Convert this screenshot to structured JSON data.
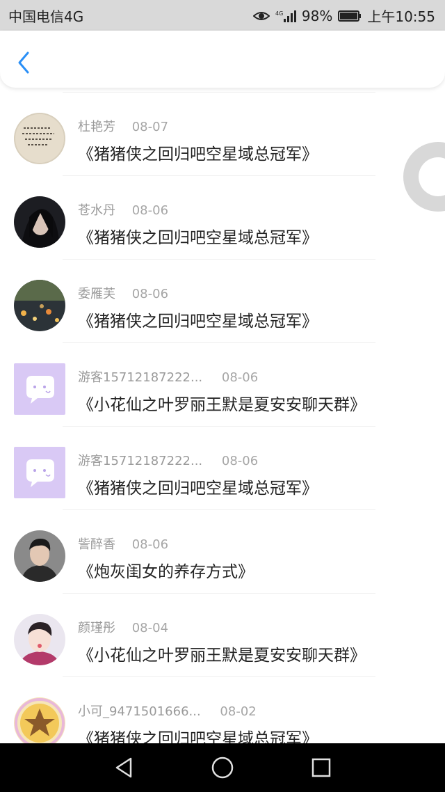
{
  "status_bar": {
    "carrier": "中国电信4G",
    "network": "4G",
    "battery": "98%",
    "time": "上午10:55"
  },
  "header": {
    "back_icon": "chevron-left-icon",
    "accent_color": "#2a8ff7"
  },
  "items": [
    {
      "name": "杜艳芳",
      "date": "08-07",
      "title": "《猪猪侠之回归吧空星域总冠军》",
      "avatar": "calligraphy-photo"
    },
    {
      "name": "苍水丹",
      "date": "08-06",
      "title": "《猪猪侠之回归吧空星域总冠军》",
      "avatar": "girl-portrait"
    },
    {
      "name": "委雁芙",
      "date": "08-06",
      "title": "《猪猪侠之回归吧空星域总冠军》",
      "avatar": "night-lights"
    },
    {
      "name": "游客15712187222...",
      "date": "08-06",
      "title": "《小花仙之叶罗丽王默是夏安安聊天群》",
      "avatar": "chat-bubble-purple"
    },
    {
      "name": "游客15712187222...",
      "date": "08-06",
      "title": "《猪猪侠之回归吧空星域总冠军》",
      "avatar": "chat-bubble-purple"
    },
    {
      "name": "訾醉香",
      "date": "08-06",
      "title": "《炮灰闺女的养存方式》",
      "avatar": "boy-portrait"
    },
    {
      "name": "颜瑾彤",
      "date": "08-04",
      "title": "《小花仙之叶罗丽王默是夏安安聊天群》",
      "avatar": "child-selfie"
    },
    {
      "name": "小可_9471501666...",
      "date": "08-02",
      "title": "《猪猪侠之回归吧空星域总冠军》",
      "avatar": "star-badge"
    }
  ],
  "nav_bar": {
    "back": "triangle-back-icon",
    "home": "circle-home-icon",
    "recents": "square-recents-icon"
  }
}
